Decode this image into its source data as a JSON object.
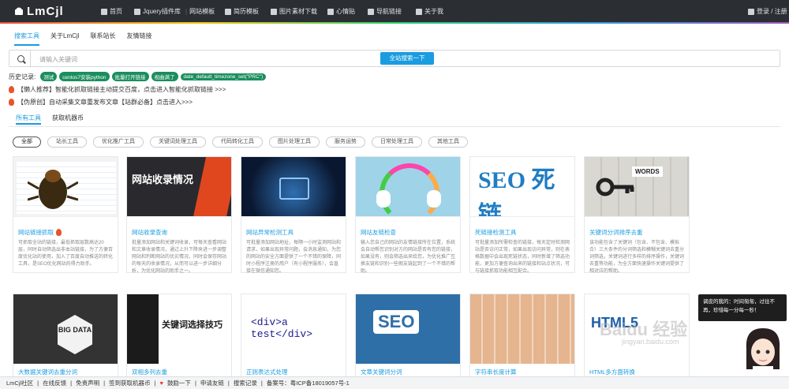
{
  "nav": {
    "logo": "LmCjl",
    "items": [
      "首页",
      "Jquery插件库",
      "网站模板",
      "简历模板",
      "图片素材下载",
      "心情贴",
      "导航链接",
      "关于我"
    ],
    "auth": "登录 / 注册"
  },
  "tabs": [
    "搜索工具",
    "关于LmCjl",
    "联系站长",
    "友情链接"
  ],
  "search": {
    "placeholder": "请输入关键词",
    "button": "全站搜索一下"
  },
  "history": {
    "label": "历史记录:",
    "tags": [
      "测试",
      "centos7安装python",
      "批量打开链接",
      "视曲满了",
      "date_default_timezone_set(\"PRC\")"
    ]
  },
  "notices": [
    "【懒人推荐】智能化抓取链接主动提交百度，点击进入智能化抓取链接 >>>",
    "【伪原创】自动采集文章重发布文章【站群必备】点击进入>>>"
  ],
  "tool_tabs": [
    "所有工具",
    "获取机器币"
  ],
  "filters": [
    "全部",
    "站长工具",
    "优化推广工具",
    "关键词处理工具",
    "代码转化工具",
    "图片处理工具",
    "服务运势",
    "日常处理工具",
    "其他工具"
  ],
  "cards": [
    {
      "title": "网站链接抓取",
      "thumb": "",
      "desc": "可抓取全站的链接，最低抓取层数高达20层，同时自动筛选出非本站链接，为了方便百度优化站的使用，加入了百度自动推送的转化工具，是SEO优化网站的得力助手。"
    },
    {
      "title": "网站收录查询",
      "thumb": "网站收录情况",
      "desc": "批量添加网站和关键词收录，可每天查看网站和文章收录情况，通过上升下降来进一步调整网站和判断网站的优劣情况，同时会保存网站的每天的收录情况，从而可以进一步详细分析，为优化网站的助手之一。"
    },
    {
      "title": "网站异常检测工具",
      "thumb": "",
      "desc": "可批量添加网站地址，每隔一小时监测网站和请求，如果出现异常问题，会消息通知，为您的网站的安全方面提供了一个不错的保障，同时小程序注册的用户（有小程序服务），会直接在微信通知您。"
    },
    {
      "title": "网站友链检查",
      "thumb": "",
      "desc": "输入您自己的网站的友情链接所在位置，系统会自动帮您识别对方的网站是否有您的链接，如果没有，则会筛选出来给您，为优化推广互换友链和识别一些假友链起到了一个不错的帮助。"
    },
    {
      "title": "死链接检测工具",
      "thumb": "SEO 死链",
      "desc": "可批量添加所需检查的链接，每天定时检测网站是否访问正常，如果出现访问异常，则在表格数据中会出现死链状态，同时新增了筛选功能，更加方便查询出来的链接和站点状况，可与链接抓取功能相互配合。"
    },
    {
      "title": "关键词分词排序去重",
      "thumb": "WORDS",
      "desc": "该功能包含了关键词（包含、不包含、模拟合）三大条件的分词筛选和模糊关键词去重分词筛选，关键词进行多样的排序操作，关键词去重等功能，为全方面快速操作关键词提供了相对应的帮助。"
    }
  ],
  "cards2": [
    {
      "title": "大数据关键词去重分词",
      "thumb": "BIG DATA"
    },
    {
      "title": "双相多列去重",
      "thumb": "关键词选择技巧"
    },
    {
      "title": "正则表达式处理",
      "thumb": "<div>a test</div>"
    },
    {
      "title": "文章关键词分词",
      "thumb": "SEO"
    },
    {
      "title": "字符串长度计算",
      "thumb": ""
    },
    {
      "title": "HTML多方面转换",
      "thumb": "HTML5"
    }
  ],
  "bottom": [
    "LmCjl社区",
    "在线反馈",
    "免责声明",
    "签到获取机器币",
    "鼓励一下",
    "申请友链",
    "搜索记录",
    "备案号：粤ICP备18019057号-1"
  ],
  "chat": "调皮的我的：时间匆匆，过往不再，珍惜每一分每一秒！",
  "watermark": "Baidu 经验",
  "watermark_url": "jingyan.baidu.com"
}
